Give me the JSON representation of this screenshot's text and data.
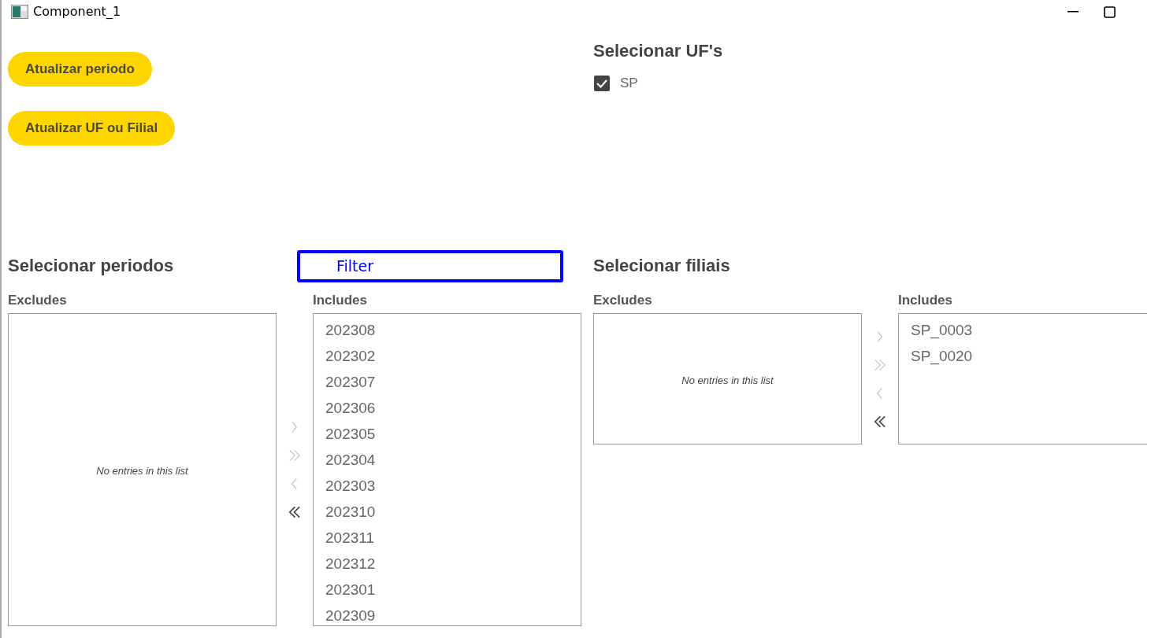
{
  "window": {
    "title": "Component_1"
  },
  "buttons": [
    {
      "label": "Atualizar periodo"
    },
    {
      "label": "Atualizar UF ou Filial"
    }
  ],
  "uf_section": {
    "title": "Selecionar UF's",
    "options": [
      {
        "label": "SP",
        "checked": true
      }
    ]
  },
  "periodos": {
    "title": "Selecionar periodos",
    "filter": {
      "placeholder": "Filter"
    },
    "excludes": {
      "label": "Excludes",
      "empty_text": "No entries in this list"
    },
    "transfer_buttons": [
      {
        "kind": "move-right",
        "disabled": true
      },
      {
        "kind": "move-all-right",
        "disabled": true
      },
      {
        "kind": "move-left",
        "disabled": true
      },
      {
        "kind": "move-all-left",
        "disabled": false
      }
    ],
    "includes": {
      "label": "Includes",
      "items": [
        "202308",
        "202302",
        "202307",
        "202306",
        "202305",
        "202304",
        "202303",
        "202310",
        "202311",
        "202312",
        "202301",
        "202309"
      ]
    }
  },
  "filiais": {
    "title": "Selecionar filiais",
    "excludes": {
      "label": "Excludes",
      "empty_text": "No entries in this list"
    },
    "transfer_buttons": [
      {
        "kind": "move-right",
        "disabled": true
      },
      {
        "kind": "move-all-right",
        "disabled": true
      },
      {
        "kind": "move-left",
        "disabled": true
      },
      {
        "kind": "move-all-left",
        "disabled": false
      }
    ],
    "includes": {
      "label": "Includes",
      "items": [
        "SP_0003",
        "SP_0020"
      ]
    }
  }
}
